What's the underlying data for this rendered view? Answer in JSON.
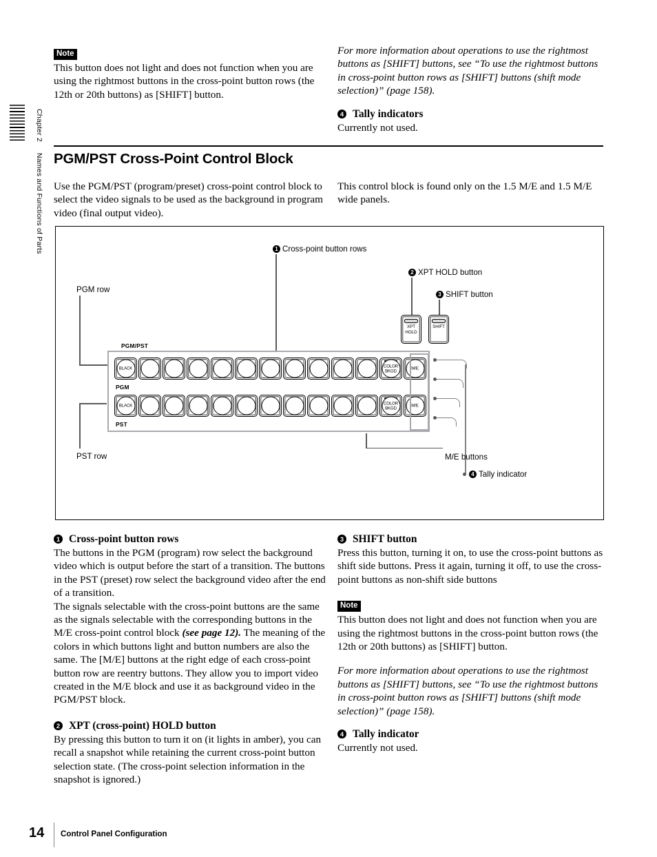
{
  "sidebar": {
    "chapter": "Chapter 2",
    "title": "Names and Functions of Parts"
  },
  "top": {
    "left": {
      "note_tag": "Note",
      "note_text": "This button does not light and does not function when you are using the rightmost buttons in the cross-point button rows (the 12th or 20th buttons) as [SHIFT] button."
    },
    "right": {
      "italic_ref": "For more information about operations to use the rightmost buttons as [SHIFT] buttons, see “To use the rightmost buttons in cross-point button rows as [SHIFT] buttons (shift mode selection)” (page 158).",
      "item4_num": "4",
      "item4_title": "Tally indicators",
      "item4_body": "Currently not used."
    }
  },
  "section": {
    "heading": "PGM/PST Cross-Point Control Block",
    "intro_left": "Use the PGM/PST (program/preset) cross-point control block to select the video signals to be used as the background in program video (final output video).",
    "intro_right": "This control block is found only on the 1.5 M/E and 1.5 M/E wide panels."
  },
  "diagram": {
    "callouts": {
      "c1_num": "1",
      "c1_label": "Cross-point button rows",
      "c2_num": "2",
      "c2_label": "XPT HOLD button",
      "c3_num": "3",
      "c3_label": "SHIFT button",
      "c4_num": "4",
      "c4_label": "Tally indicator",
      "pgm_row": "PGM row",
      "pst_row": "PST row",
      "me_buttons": "M/E buttons"
    },
    "panel": {
      "module_label": "PGM/PST",
      "pgm_label": "PGM",
      "pst_label": "PST",
      "first_button": "BLACK",
      "color_bkgd_line1": "COLOR",
      "color_bkgd_line2": "BKGD",
      "me_button": "M/E",
      "blank_count": 10,
      "xpt_hold_line1": "XPT",
      "xpt_hold_line2": "HOLD",
      "shift_label": "SHIFT",
      "tally_dots": 4
    }
  },
  "bottom": {
    "left": {
      "item1_num": "1",
      "item1_title": "Cross-point button rows",
      "item1_p1": "The buttons in the PGM (program) row select the background video which is output before the start of a transition. The buttons in the PST (preset) row select the background video after the end of a transition.",
      "item1_p2_a": "The signals selectable with the cross-point buttons are the same as the signals selectable with the corresponding buttons in the M/E cross-point control block ",
      "item1_p2_ital": "(see page 12).",
      "item1_p2_b": " The meaning of the colors in which buttons light and button numbers are also the same. The [M/E] buttons at the right edge of each cross-point button row are reentry buttons. They allow you to import video created in the M/E block and use it as background video in the PGM/PST block.",
      "item2_num": "2",
      "item2_title": "XPT (cross-point) HOLD button",
      "item2_body": "By pressing this button to turn it on (it lights in amber), you can recall a snapshot while retaining the current cross-point button selection state. (The cross-point selection information in the snapshot is ignored.)"
    },
    "right": {
      "item3_num": "3",
      "item3_title": "SHIFT button",
      "item3_body": "Press this button, turning it on, to use the cross-point buttons as shift side buttons. Press it again, turning it off, to use the cross-point buttons as non-shift side buttons",
      "note_tag": "Note",
      "note_text": "This button does not light and does not function when you are using the rightmost buttons in the cross-point button rows (the 12th or 20th buttons) as [SHIFT] button.",
      "italic_ref": "For more information about operations to use the rightmost buttons as [SHIFT] buttons, see “To use the rightmost buttons in cross-point button rows as [SHIFT] buttons (shift mode selection)” (page 158).",
      "item4_num": "4",
      "item4_title": "Tally indicator",
      "item4_body": "Currently not used."
    }
  },
  "footer": {
    "page_number": "14",
    "running_title": "Control Panel Configuration"
  }
}
